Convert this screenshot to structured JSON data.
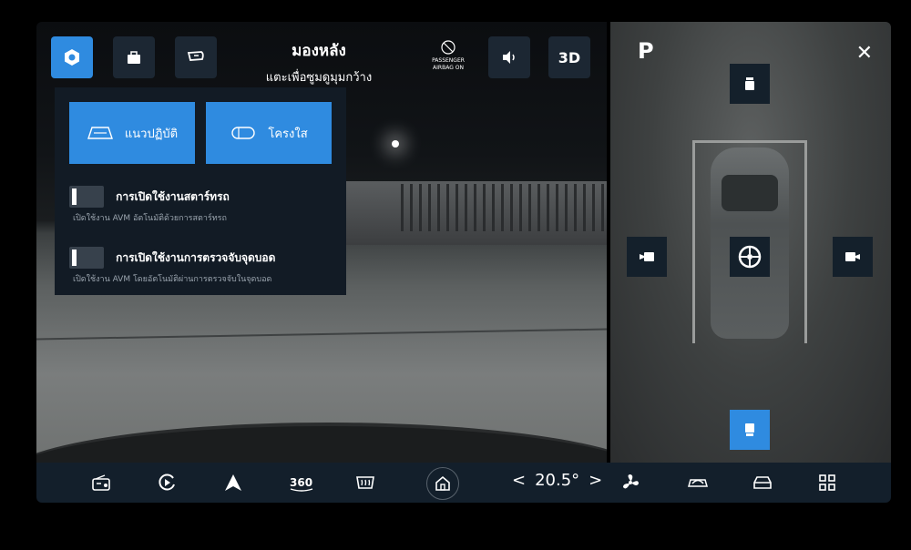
{
  "camera": {
    "title": "มองหลัง",
    "subtitle": "แตะเพื่อซูมดูมุมกว้าง",
    "airbag_line1": "PASSENGER",
    "airbag_line2": "AIRBAG ON",
    "btn_3d": "3D"
  },
  "settings_panel": {
    "mode_guide_label": "แนวปฏิบัติ",
    "mode_transparent_label": "โครงใส",
    "toggle1_label": "การเปิดใช้งานสตาร์ทรถ",
    "toggle1_sub": "เปิดใช้งาน AVM อัตโนมัติด้วยการสตาร์ทรถ",
    "toggle2_label": "การเปิดใช้งานการตรวจจับจุดบอด",
    "toggle2_sub": "เปิดใช้งาน AVM โดยอัตโนมัติผ่านการตรวจจับในจุดบอด"
  },
  "birdseye": {
    "gear": "P",
    "close": "✕"
  },
  "bottom_bar": {
    "temperature": "20.5°",
    "temp_left": "<",
    "temp_right": ">"
  },
  "colors": {
    "accent": "#2f8be0",
    "panel": "#121b25",
    "bar": "#131f2b"
  }
}
